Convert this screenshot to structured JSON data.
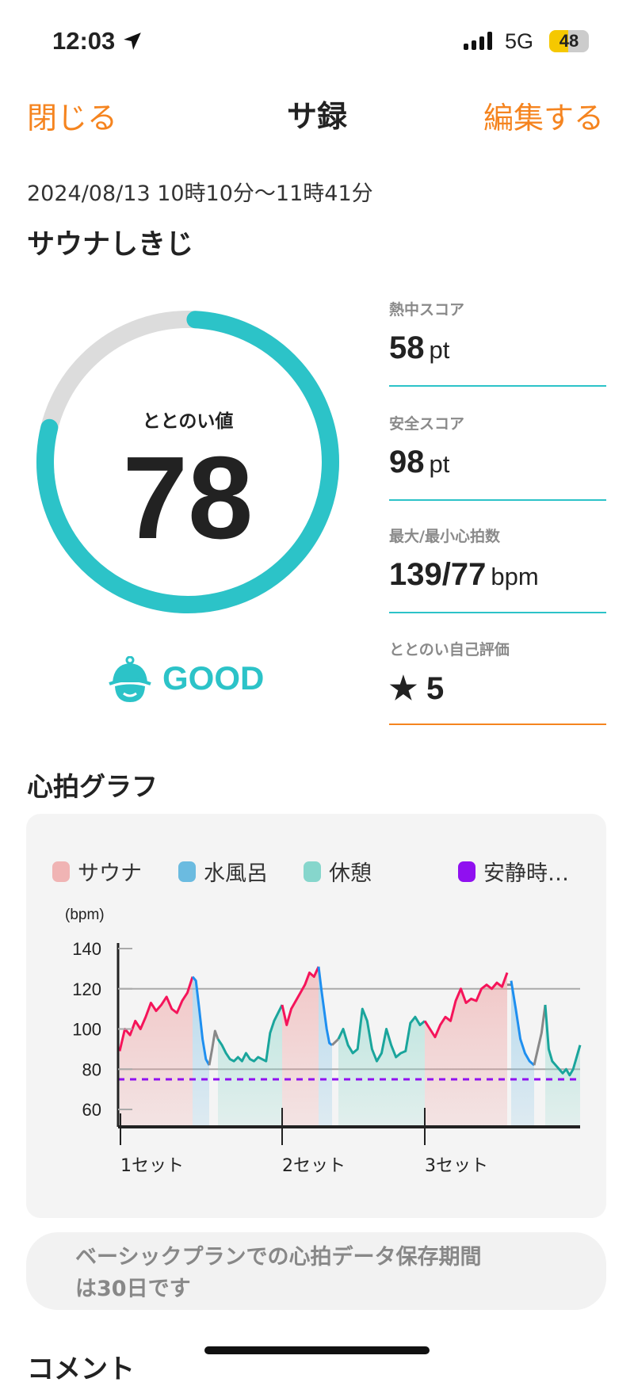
{
  "status_bar": {
    "time": "12:03",
    "network": "5G",
    "battery": "48",
    "location_icon": "location-arrow-icon",
    "signal_icon": "signal-bars-icon"
  },
  "nav": {
    "close": "閉じる",
    "title": "サ録",
    "edit": "編集する"
  },
  "session": {
    "datetime": "2024/08/13 10時10分〜11時41分",
    "place": "サウナしきじ"
  },
  "totonoi": {
    "label": "ととのい値",
    "value": "78",
    "percent": 78,
    "rating": "GOOD",
    "rating_icon": "sauna-hat-face-icon",
    "color": "#2cc3c8"
  },
  "metrics": [
    {
      "label": "熱中スコア",
      "value": "58",
      "unit": "pt"
    },
    {
      "label": "安全スコア",
      "value": "98",
      "unit": "pt"
    },
    {
      "label": "最大/最小心拍数",
      "value": "139/77",
      "unit": "bpm"
    },
    {
      "label": "ととのい自己評価",
      "value": "5",
      "icon": "star-icon"
    }
  ],
  "graph_section": {
    "title": "心拍グラフ"
  },
  "chart_data": {
    "type": "line",
    "ylabel": "(bpm)",
    "yticks": [
      140,
      120,
      100,
      80,
      60
    ],
    "ylim": [
      52,
      142
    ],
    "grid_lines": [
      120,
      80
    ],
    "xtick_labels": [
      "1セット",
      "2セット",
      "3セット"
    ],
    "legend": [
      {
        "name": "サウナ",
        "color": "#f0b4b4"
      },
      {
        "name": "水風呂",
        "color": "#6bbbe0"
      },
      {
        "name": "休憩",
        "color": "#86d6cc"
      },
      {
        "name": "安静時…",
        "color": "#9010f0"
      }
    ],
    "resting_hr": 75,
    "segments": [
      {
        "phase": "sauna",
        "values": [
          89,
          100,
          97,
          104,
          100,
          106,
          113,
          109,
          112,
          116,
          110,
          108,
          114,
          118,
          126
        ]
      },
      {
        "phase": "cold",
        "values": [
          126,
          124,
          110,
          95,
          85,
          82
        ]
      },
      {
        "phase": "gap",
        "values": [
          82,
          90,
          99,
          95
        ]
      },
      {
        "phase": "rest",
        "values": [
          95,
          92,
          88,
          85,
          84,
          86,
          84,
          88,
          85,
          84,
          86,
          85,
          84,
          98,
          104,
          108,
          112
        ]
      },
      {
        "phase": "sauna",
        "values": [
          112,
          102,
          110,
          114,
          118,
          122,
          128,
          126,
          131
        ]
      },
      {
        "phase": "cold",
        "values": [
          131,
          120,
          110,
          100,
          93,
          92
        ]
      },
      {
        "phase": "gap",
        "values": [
          92,
          95
        ]
      },
      {
        "phase": "rest",
        "values": [
          95,
          100,
          92,
          88,
          90,
          110,
          104,
          90,
          84,
          88,
          100,
          92,
          86,
          88,
          89,
          103,
          106,
          102,
          104
        ]
      },
      {
        "phase": "sauna",
        "values": [
          104,
          100,
          96,
          102,
          106,
          104,
          114,
          120,
          113,
          115,
          114,
          120,
          122,
          120,
          123,
          121,
          128
        ]
      },
      {
        "phase": "gap",
        "values": [
          122,
          122
        ]
      },
      {
        "phase": "cold",
        "values": [
          124,
          110,
          95,
          88,
          84,
          82
        ]
      },
      {
        "phase": "gap",
        "values": [
          82,
          90,
          98,
          112
        ]
      },
      {
        "phase": "rest",
        "values": [
          112,
          90,
          84,
          82,
          80,
          78,
          80,
          77,
          80,
          86,
          92
        ]
      }
    ]
  },
  "notice": "ベーシックプランでの心拍データ保存期間は30日です",
  "notice_lines": [
    "ベーシックプランでの心拍データ保存期間",
    "は30日です"
  ],
  "comment_title": "コメント"
}
